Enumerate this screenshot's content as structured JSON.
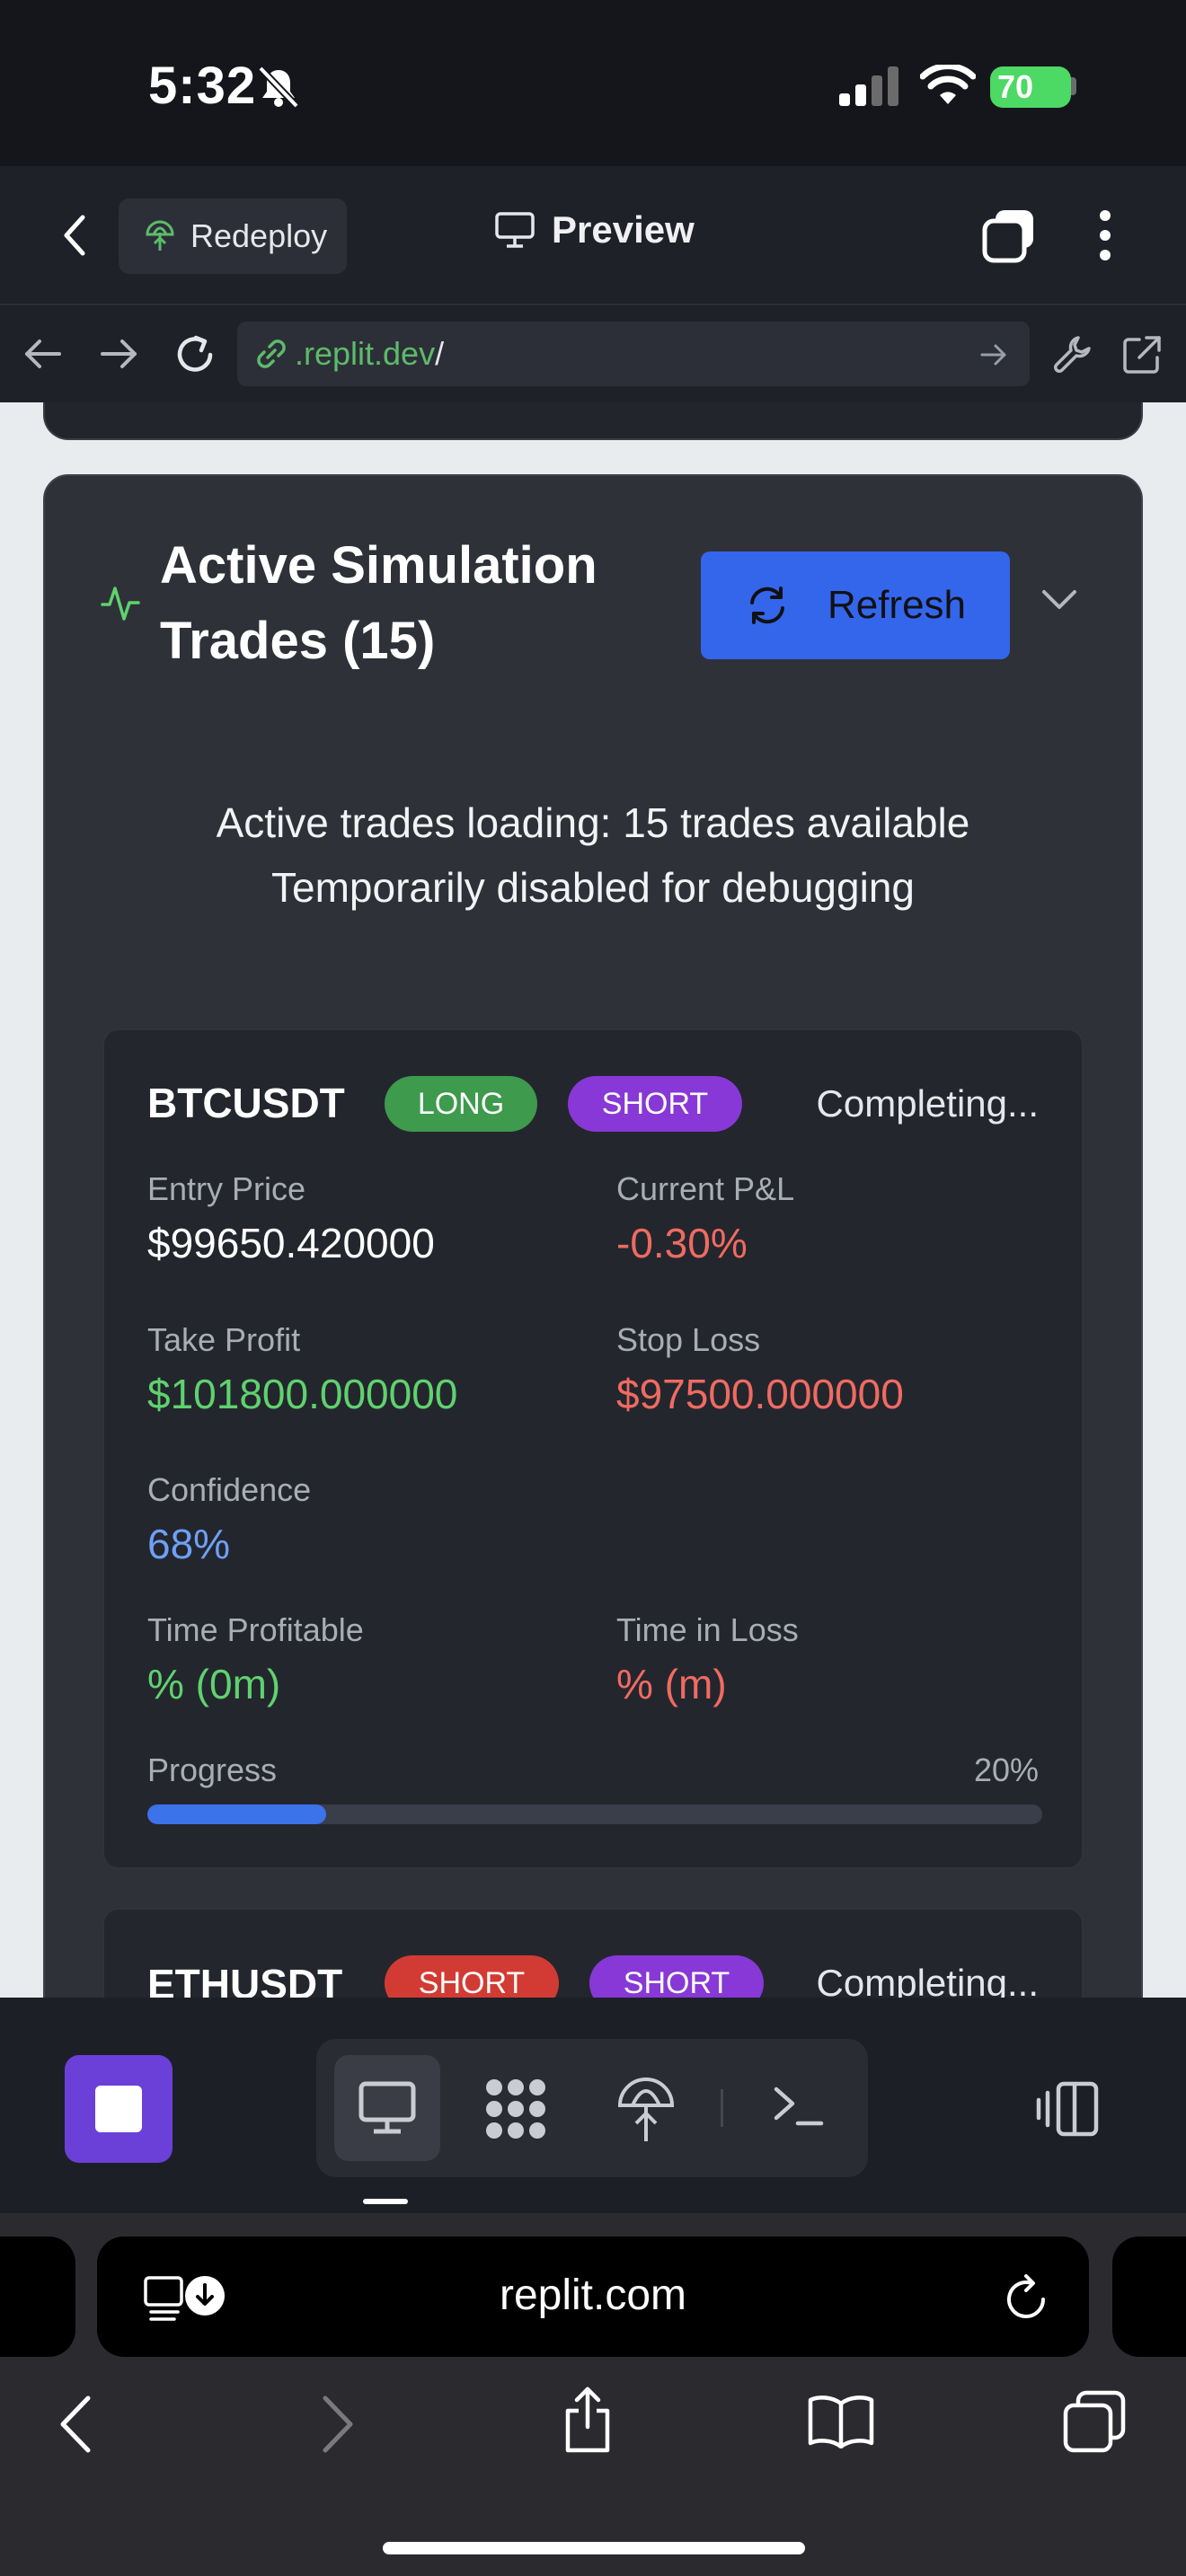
{
  "status_bar": {
    "time": "5:32",
    "battery": "70"
  },
  "header": {
    "redeploy_label": "Redeploy",
    "preview_label": "Preview"
  },
  "url_bar": {
    "domain_part": ".replit.dev",
    "path_part": "/"
  },
  "card": {
    "title_line1": "Active Simulation",
    "title_line2": "Trades (15)",
    "refresh_label": "Refresh",
    "notice_line1": "Active trades loading: 15 trades available",
    "notice_line2": "Temporarily disabled for debugging"
  },
  "trades": [
    {
      "symbol": "BTCUSDT",
      "badge1": "LONG",
      "badge2": "SHORT",
      "status": "Completing...",
      "entry_price_label": "Entry Price",
      "entry_price": "$99650.420000",
      "pnl_label": "Current P&L",
      "pnl": "-0.30%",
      "take_profit_label": "Take Profit",
      "take_profit": "$101800.000000",
      "stop_loss_label": "Stop Loss",
      "stop_loss": "$97500.000000",
      "confidence_label": "Confidence",
      "confidence": "68%",
      "time_profitable_label": "Time Profitable",
      "time_profitable": "% (0m)",
      "time_in_loss_label": "Time in Loss",
      "time_in_loss": "% (m)",
      "progress_label": "Progress",
      "progress_text": "20%",
      "progress_value": 20
    },
    {
      "symbol": "ETHUSDT",
      "badge1": "SHORT",
      "badge2": "SHORT",
      "status": "Completing..."
    }
  ],
  "safari": {
    "domain": "replit.com"
  },
  "colors": {
    "accent_blue": "#3466eb",
    "long_green": "#3e9a4d",
    "short_red": "#d23b33",
    "short_purple": "#8738d6"
  }
}
